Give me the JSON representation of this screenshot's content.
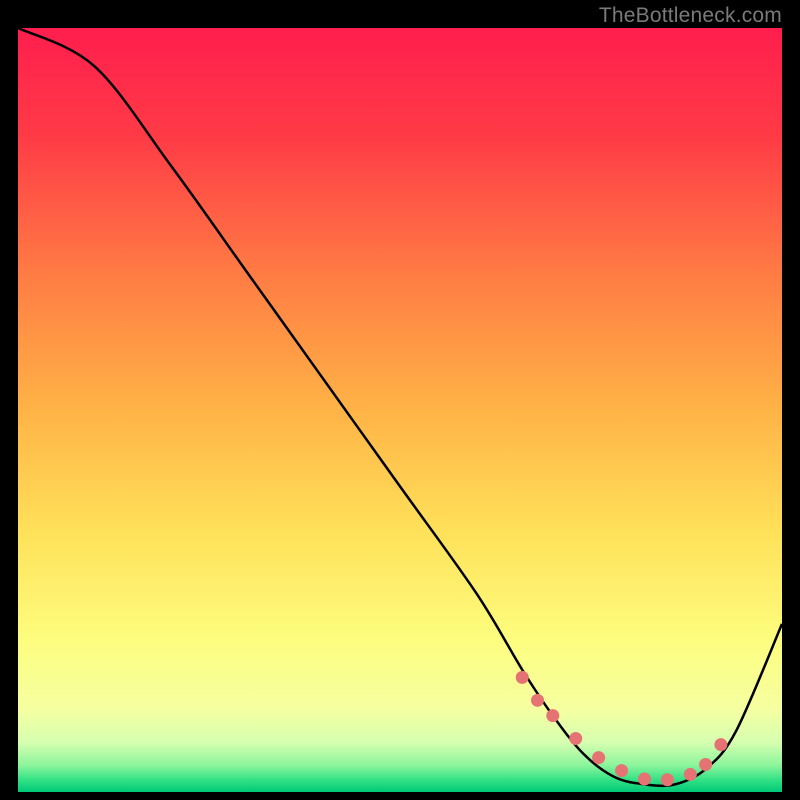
{
  "watermark": "TheBottleneck.com",
  "chart_data": {
    "type": "line",
    "title": "",
    "xlabel": "",
    "ylabel": "",
    "xlim": [
      0,
      100
    ],
    "ylim": [
      0,
      100
    ],
    "series": [
      {
        "name": "curve",
        "x": [
          0,
          10,
          20,
          30,
          40,
          50,
          60,
          66,
          70,
          74,
          78,
          82,
          86,
          90,
          94,
          100
        ],
        "y": [
          100,
          95,
          82,
          68,
          54,
          40,
          26,
          16,
          10,
          5,
          2,
          1,
          1,
          3,
          8,
          22
        ]
      }
    ],
    "gradient_stops": [
      {
        "offset": 0,
        "color": "#ff1e4e"
      },
      {
        "offset": 0.14,
        "color": "#ff3a46"
      },
      {
        "offset": 0.32,
        "color": "#ff7b44"
      },
      {
        "offset": 0.5,
        "color": "#ffb346"
      },
      {
        "offset": 0.66,
        "color": "#ffe15a"
      },
      {
        "offset": 0.8,
        "color": "#fdfd7e"
      },
      {
        "offset": 0.89,
        "color": "#f6ffa0"
      },
      {
        "offset": 0.935,
        "color": "#d6ffb0"
      },
      {
        "offset": 0.965,
        "color": "#8cf59c"
      },
      {
        "offset": 0.985,
        "color": "#2fe084"
      },
      {
        "offset": 1.0,
        "color": "#00c877"
      }
    ],
    "dots": {
      "name": "highlights",
      "x": [
        66,
        68,
        70,
        73,
        76,
        79,
        82,
        85,
        88,
        90,
        92
      ],
      "y": [
        15,
        12,
        10,
        7,
        4.5,
        2.8,
        1.7,
        1.6,
        2.3,
        3.6,
        6.2
      ],
      "color": "#e57373"
    }
  }
}
